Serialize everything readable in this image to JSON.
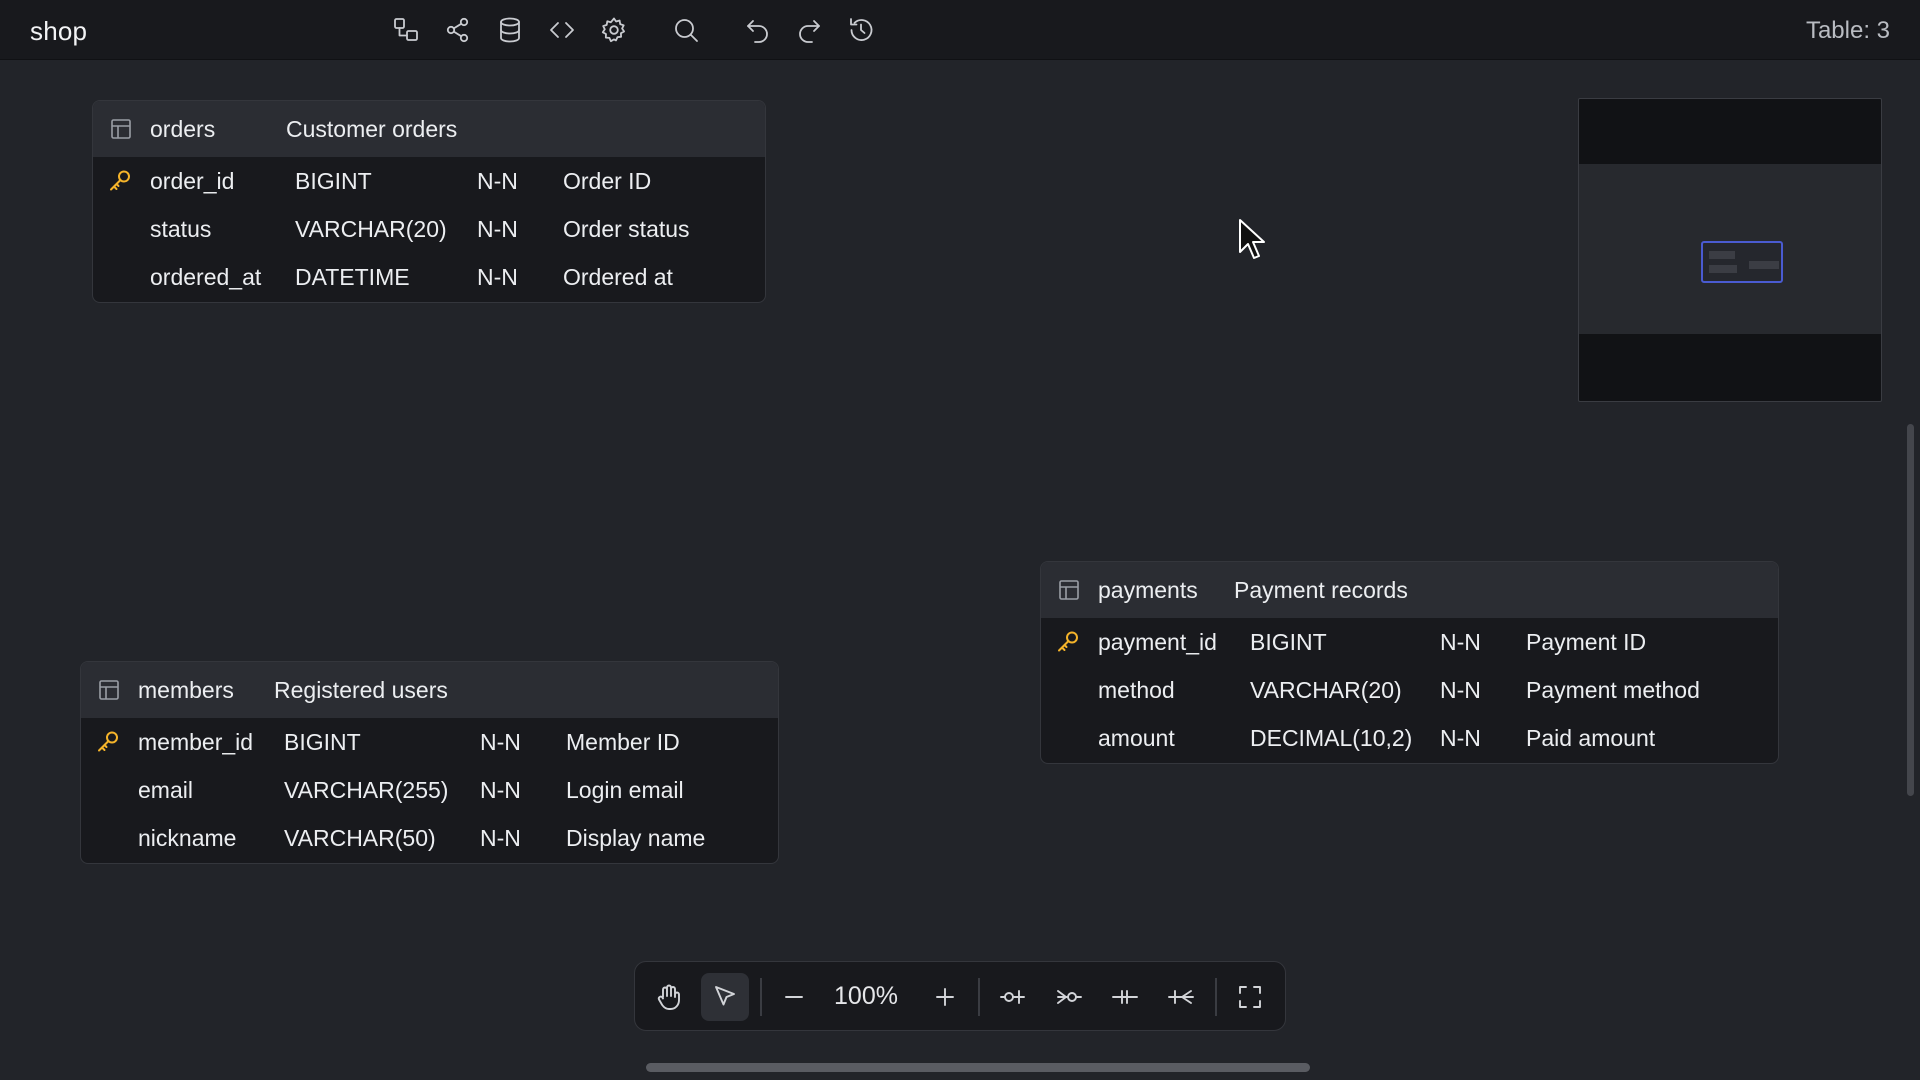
{
  "app": {
    "title": "shop",
    "table_count": "Table: 3"
  },
  "toolbar": {
    "icons": [
      "diagram-icon",
      "share-icon",
      "database-icon",
      "code-icon",
      "settings-icon",
      "search-icon",
      "undo-icon",
      "redo-icon",
      "history-icon"
    ]
  },
  "tables": {
    "orders": {
      "name": "orders",
      "comment": "Customer orders",
      "columns": [
        {
          "name": "order_id",
          "type": "BIGINT",
          "nullable": "N-N",
          "comment": "Order ID",
          "pk": true
        },
        {
          "name": "status",
          "type": "VARCHAR(20)",
          "nullable": "N-N",
          "comment": "Order status",
          "pk": false
        },
        {
          "name": "ordered_at",
          "type": "DATETIME",
          "nullable": "N-N",
          "comment": "Ordered at",
          "pk": false
        }
      ]
    },
    "payments": {
      "name": "payments",
      "comment": "Payment records",
      "columns": [
        {
          "name": "payment_id",
          "type": "BIGINT",
          "nullable": "N-N",
          "comment": "Payment ID",
          "pk": true
        },
        {
          "name": "method",
          "type": "VARCHAR(20)",
          "nullable": "N-N",
          "comment": "Payment method",
          "pk": false
        },
        {
          "name": "amount",
          "type": "DECIMAL(10,2)",
          "nullable": "N-N",
          "comment": "Paid amount",
          "pk": false
        }
      ]
    },
    "members": {
      "name": "members",
      "comment": "Registered users",
      "columns": [
        {
          "name": "member_id",
          "type": "BIGINT",
          "nullable": "N-N",
          "comment": "Member ID",
          "pk": true
        },
        {
          "name": "email",
          "type": "VARCHAR(255)",
          "nullable": "N-N",
          "comment": "Login email",
          "pk": false
        },
        {
          "name": "nickname",
          "type": "VARCHAR(50)",
          "nullable": "N-N",
          "comment": "Display name",
          "pk": false
        }
      ]
    }
  },
  "bottombar": {
    "zoom": "100%",
    "active_tool": "select",
    "icons": [
      "hand-icon",
      "pointer-icon",
      "zoom-out-icon",
      "zoom-in-icon",
      "one-to-one-icon",
      "one-to-many-icon",
      "zero-one-icon",
      "zero-many-icon",
      "fullscreen-icon"
    ]
  },
  "colors": {
    "accent": "#4a5bd1",
    "key": "#f5b42a",
    "canvas": "#222429",
    "card": "#18191d",
    "card_header": "#2b2d33"
  }
}
